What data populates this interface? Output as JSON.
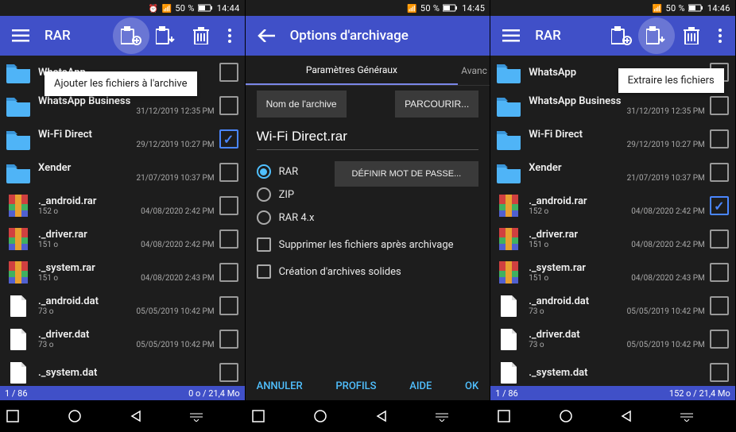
{
  "status": {
    "battery": "50 %",
    "time1": "14:44",
    "time2": "14:45",
    "time3": "14:46"
  },
  "app": {
    "title": "RAR",
    "options_title": "Options d'archivage"
  },
  "tooltip": {
    "add": "Ajouter les fichiers à l'archive",
    "extract": "Extraire les fichiers"
  },
  "tabs": {
    "general": "Paramètres Généraux",
    "advanced": "Avanc"
  },
  "opt": {
    "name_label": "Nom de l'archive",
    "browse": "PARCOURIR...",
    "archive_name": "Wi-Fi Direct.rar",
    "set_pw": "DÉFINIR MOT DE PASSE...",
    "fmt_rar": "RAR",
    "fmt_zip": "ZIP",
    "fmt_rar4": "RAR 4.x",
    "delete_after": "Supprimer les fichiers après archivage",
    "solid": "Création d'archives solides",
    "cancel": "ANNULER",
    "profiles": "PROFILS",
    "help": "AIDE",
    "ok": "OK"
  },
  "count": {
    "left1": "1 / 86",
    "right1": "0 o / 21,4 Mo",
    "left3": "1 / 86",
    "right3": "152 o / 21,4 Mo"
  },
  "files": [
    {
      "type": "folder",
      "name": "WhatsApp",
      "size": "",
      "date": ""
    },
    {
      "type": "folder",
      "name": "WhatsApp Business",
      "size": "",
      "date": "31/12/2019 12:35 PM"
    },
    {
      "type": "folder",
      "name": "Wi-Fi Direct",
      "size": "",
      "date": "29/12/2019 10:27 PM"
    },
    {
      "type": "folder",
      "name": "Xender",
      "size": "",
      "date": "21/07/2019 10:37 PM"
    },
    {
      "type": "rar",
      "name": "._android.rar",
      "size": "152 o",
      "date": "04/08/2020 2:42 PM"
    },
    {
      "type": "rar",
      "name": "._driver.rar",
      "size": "151 o",
      "date": "04/08/2020 2:42 PM"
    },
    {
      "type": "rar",
      "name": "._system.rar",
      "size": "151 o",
      "date": "04/08/2020 2:43 PM"
    },
    {
      "type": "dat",
      "name": "._android.dat",
      "size": "73 o",
      "date": "05/05/2019 10:42 PM"
    },
    {
      "type": "dat",
      "name": "._driver.dat",
      "size": "73 o",
      "date": "05/05/2019 10:42 PM"
    },
    {
      "type": "dat",
      "name": "._system.dat",
      "size": "",
      "date": ""
    }
  ],
  "checked_screen1_index": 2,
  "checked_screen3_index": 4
}
